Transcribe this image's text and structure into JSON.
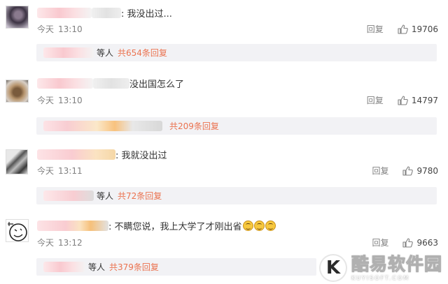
{
  "comments": [
    {
      "text": ": 我没出过...",
      "time_label": "今天",
      "time": "13:10",
      "reply_label": "回复",
      "likes": "19706",
      "sub_who": "等人",
      "sub_count": "共654条回复"
    },
    {
      "text": "没出国怎么了",
      "time_label": "今天",
      "time": "13:10",
      "reply_label": "回复",
      "likes": "14797",
      "sub_who": "",
      "sub_count": "共209条回复"
    },
    {
      "text": ": 我就没出过",
      "time_label": "今天",
      "time": "13:11",
      "reply_label": "回复",
      "likes": "9780",
      "sub_who": "等人",
      "sub_count": "共72条回复"
    },
    {
      "text": ": 不瞒您说，我上大学了才刚出省",
      "time_label": "今天",
      "time": "13:12",
      "reply_label": "回复",
      "likes": "9663",
      "sub_who": "等人",
      "sub_count": "共379条回复"
    }
  ],
  "watermark": {
    "logo_letter": "K",
    "name": "酷易软件园",
    "domain": "KUYISOFT.COM"
  },
  "colors": {
    "reply_count": "#eb7350",
    "meta_gray": "#808080",
    "subbox_bg": "#f2f2f5"
  },
  "icons": {
    "like": "thumbs-up-icon",
    "emoji": "smile-emoji-icon"
  }
}
